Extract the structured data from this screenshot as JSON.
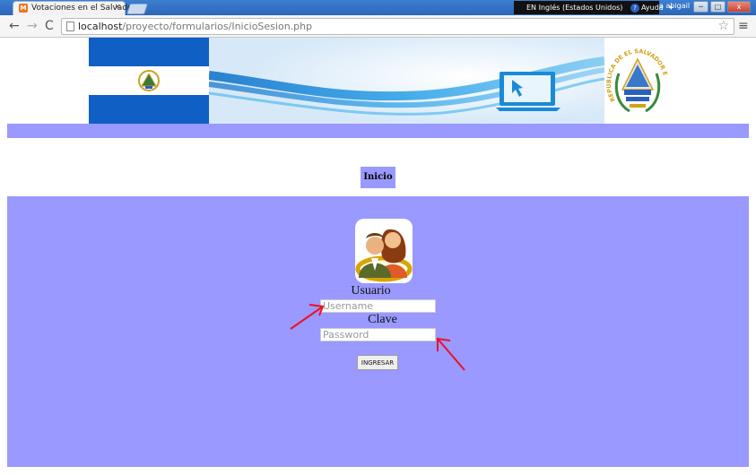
{
  "browser": {
    "tab_title": "Votaciones en el Salvador",
    "tab_close": "×",
    "favicon_letter": "M",
    "language_bar": "EN Inglés (Estados Unidos)",
    "help_label": "Ayuda",
    "help_glyph": "?",
    "language_arrow": "▾",
    "user_name": "a abigail",
    "window_minimize": "─",
    "window_maximize": "□",
    "window_close": "x",
    "nav_back": "←",
    "nav_forward": "→",
    "nav_reload": "C",
    "url_host": "localhost",
    "url_path": "/proyecto/formularios/InicioSesion.php",
    "bookmark_star": "☆",
    "menu_glyph": "≡"
  },
  "banner": {
    "seal_text": "REPUBLICA DE EL SALVADOR E",
    "colors": {
      "flag_blue": "#0f5fc4",
      "wave_blue": "#1a8ad8"
    }
  },
  "nav": {
    "inicio_label": "Inicio"
  },
  "login": {
    "usuario_label": "Usuario",
    "username_placeholder": "Username",
    "clave_label": "Clave",
    "password_placeholder": "Password",
    "submit_label": "INGRESAR"
  },
  "colors": {
    "panel": "#9999ff",
    "annotation_arrow": "#ee1122"
  }
}
